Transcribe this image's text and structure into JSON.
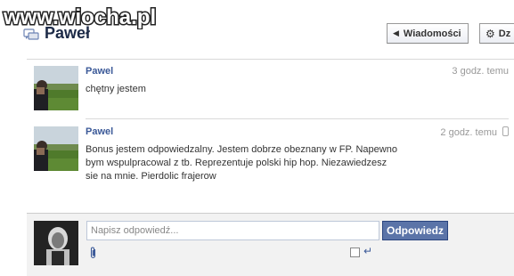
{
  "watermark": {
    "text": "www.wiocha.pl"
  },
  "header": {
    "title": "Paweł",
    "messages_button": "Wiadomości",
    "actions_button": "Dz"
  },
  "messages": [
    {
      "author": "Pawel",
      "text": "chętny jestem",
      "time": "3 godz. temu"
    },
    {
      "author": "Pawel",
      "text": "Bonus jestem odpowiedzalny. Jestem dobrze obeznany w FP. Napewno bym wspulpracowal z tb. Reprezentuje polski hip hop. Niezawiedzesz sie na mnie. Pierdolic frajerow",
      "time": "2 godz. temu"
    }
  ],
  "reply": {
    "placeholder": "Napisz odpowiedź...",
    "button": "Odpowiedz"
  },
  "icons": {
    "header": "conversation-icon",
    "messages_button": "back-arrow-icon",
    "actions_button": "gear-icon",
    "attach": "paperclip-icon",
    "enter": "enter-key-icon",
    "message_source": "mobile-phone-icon"
  },
  "colors": {
    "link": "#3b5998",
    "title": "#1c2a47",
    "button_bg": "#5b74a8",
    "timestamp": "#999999",
    "reply_area": "#f2f2f2"
  }
}
